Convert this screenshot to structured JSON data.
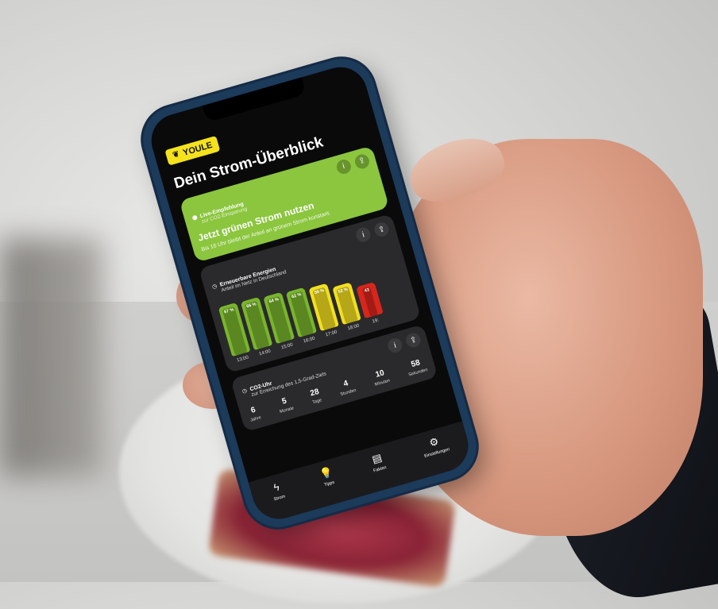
{
  "app": {
    "brand": "YOULE",
    "title": "Dein Strom-Überblick"
  },
  "live_card": {
    "label": "Live-Empfehlung",
    "sublabel": "zur CO2-Einsparung",
    "headline": "Jetzt grünen Strom nutzen",
    "text": "Bis 16 Uhr bleibt der Anteil an grünem Strom konstant.",
    "color": "#8bc63e"
  },
  "renewables_card": {
    "label": "Erneuerbare Energien",
    "sublabel": "Anteil im Netz in Deutschland",
    "bars": [
      {
        "pct": "67 %",
        "time": "13:00",
        "value": 67,
        "color": "#79b52c"
      },
      {
        "pct": "66 %",
        "time": "14:00",
        "value": 66,
        "color": "#79b52c"
      },
      {
        "pct": "64 %",
        "time": "15:00",
        "value": 64,
        "color": "#79b52c"
      },
      {
        "pct": "62 %",
        "time": "16:00",
        "value": 62,
        "color": "#79b52c"
      },
      {
        "pct": "59 %",
        "time": "17:00",
        "value": 59,
        "color": "#f2df1f"
      },
      {
        "pct": "52 %",
        "time": "18:00",
        "value": 52,
        "color": "#f2df1f"
      },
      {
        "pct": "43",
        "time": "19:",
        "value": 43,
        "color": "#d8261c"
      }
    ]
  },
  "co2_card": {
    "label": "CO2-Uhr",
    "sublabel": "zur Erreichung des 1,5-Grad-Ziels",
    "items": [
      {
        "value": "6",
        "unit": "Jahre"
      },
      {
        "value": "5",
        "unit": "Monate"
      },
      {
        "value": "28",
        "unit": "Tage"
      },
      {
        "value": "4",
        "unit": "Stunden"
      },
      {
        "value": "10",
        "unit": "Minuten"
      },
      {
        "value": "58",
        "unit": "Sekunden"
      }
    ]
  },
  "nav": {
    "strom": "Strom",
    "tipps": "Tipps",
    "fakten": "Fakten",
    "einstellungen": "Einstellungen"
  },
  "icons": {
    "info": "info-icon",
    "share": "share-icon",
    "bolt": "bolt-icon",
    "bulb": "lightbulb-icon",
    "doc": "document-icon",
    "gear": "gear-icon"
  }
}
